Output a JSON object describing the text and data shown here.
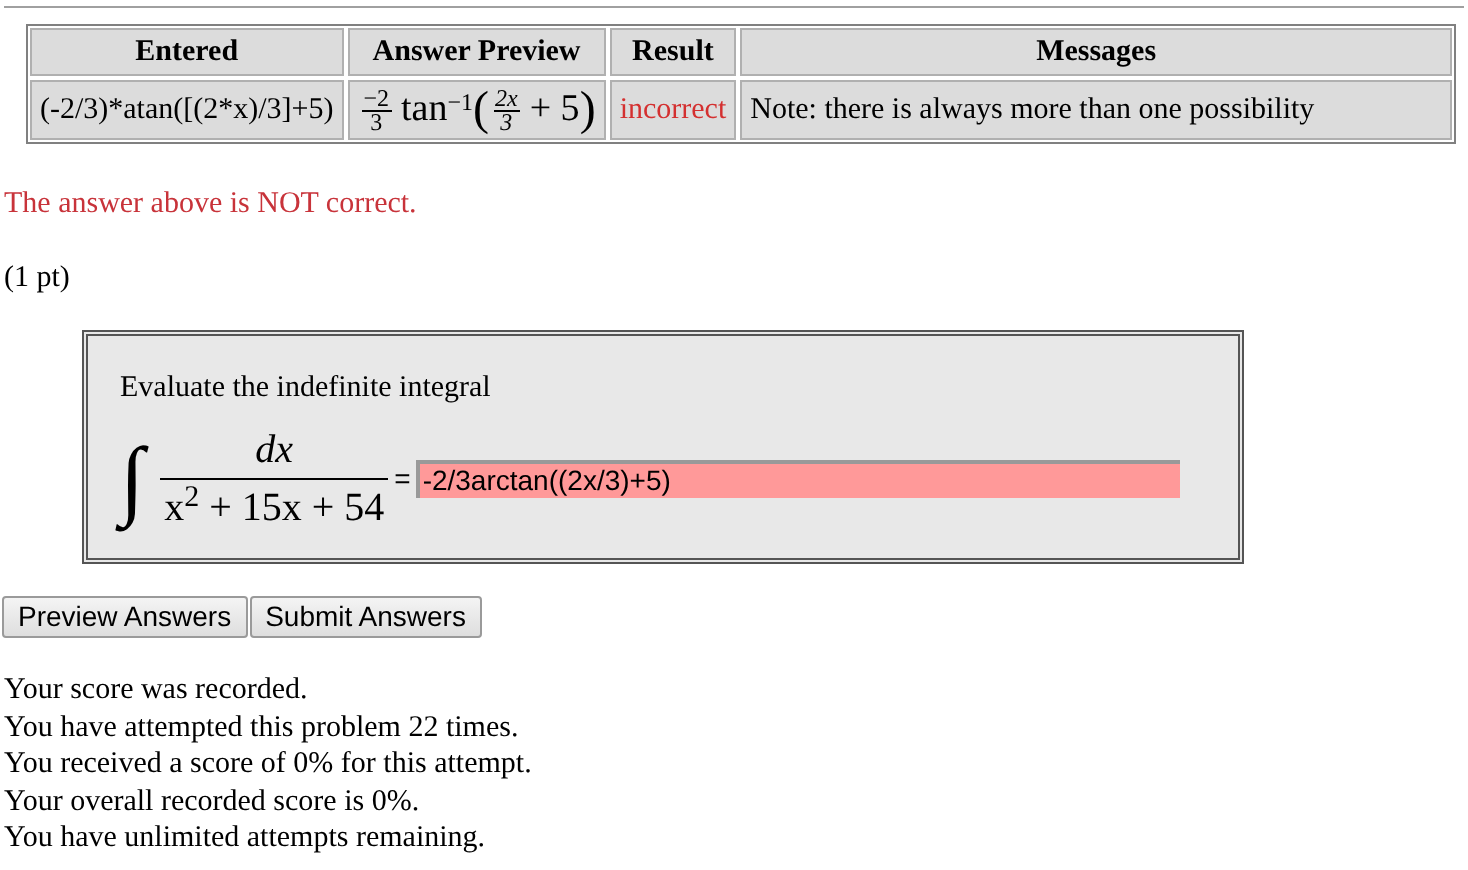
{
  "results_table": {
    "columns": [
      "Entered",
      "Answer Preview",
      "Result",
      "Messages"
    ],
    "rows": [
      {
        "entered": "(-2/3)*atan([(2*x)/3]+5)",
        "preview": {
          "coef_num": "−2",
          "coef_den": "3",
          "func": "tan",
          "power": "−1",
          "open": "(",
          "inner_num": "2x",
          "inner_den": "3",
          "rest": "+ 5",
          "close": ")"
        },
        "result": "incorrect",
        "correct": false,
        "message": "Note: there is always more than one possibility"
      }
    ]
  },
  "feedback": {
    "text": "The answer above is NOT correct.",
    "correct": false
  },
  "points": "(1 pt)",
  "problem": {
    "prompt": "Evaluate the indefinite integral",
    "integral_sign": "∫",
    "numerator": "dx",
    "denominator": "x$^{2}$ + 15x + 54",
    "equals": "=",
    "answer": {
      "value": "-2/3arctan((2x/3)+5)",
      "correct": false
    }
  },
  "buttons": [
    "Preview Answers",
    "Submit Answers"
  ],
  "score_lines": [
    "Your score was recorded.",
    "You have attempted this problem 22 times.",
    "You received a score of 0% for this attempt.",
    "Your overall recorded score is 0%.",
    "You have unlimited attempts remaining."
  ]
}
